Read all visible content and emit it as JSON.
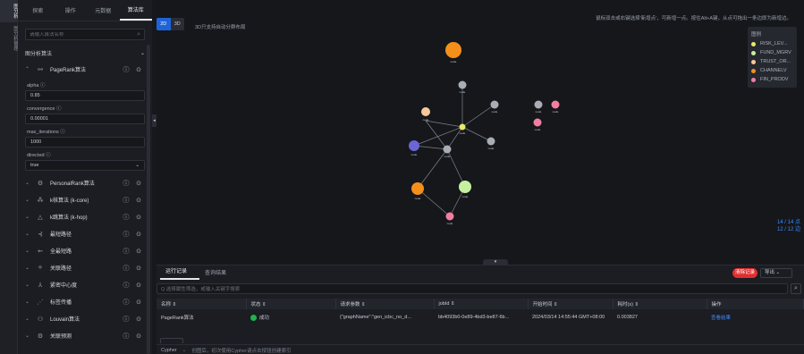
{
  "rail": {
    "items": [
      "图分析",
      "图分析管理"
    ]
  },
  "left": {
    "tabs": [
      "探索",
      "操作",
      "元数据",
      "算法库"
    ],
    "search_placeholder": "请输入算法名称",
    "section_title": "图分析算法",
    "pagerank": {
      "name": "PageRank算法",
      "params": [
        {
          "label": "alpha",
          "value": "0.85"
        },
        {
          "label": "convergence",
          "value": "0.00001"
        },
        {
          "label": "max_iterations",
          "value": "1000"
        },
        {
          "label": "directed",
          "value": "true"
        }
      ]
    },
    "algorithms": [
      "PersonalRank算法",
      "k核算法 (k-core)",
      "k跳算法 (k-hop)",
      "最短路径",
      "全最短路",
      "关联路径",
      "紧密中心度",
      "标签传播",
      "Louvain算法",
      "关联预测"
    ]
  },
  "canvas": {
    "mode_2d": "2D",
    "mode_3d": "3D",
    "hint_3d": "3D只支持自动分群布局",
    "hint_top": "鼠标双击或右键选择'新增点'，可新增一点。按住Alt+A键，从点可拖出一条边即为新增边。",
    "legend_title": "图例",
    "legend": [
      {
        "label": "RISK_LEV...",
        "color": "#e8e86a"
      },
      {
        "label": "FUND_MGRV",
        "color": "#c6f0a0"
      },
      {
        "label": "TRUST_OR...",
        "color": "#f6c89a"
      },
      {
        "label": "CHANNELV",
        "color": "#f4901a"
      },
      {
        "label": "FIN_PRODV",
        "color": "#f37ea1"
      }
    ],
    "stats_nodes": "14 / 14 点",
    "stats_edges": "12 / 12 边",
    "node_label": "node"
  },
  "bottom": {
    "tabs": [
      "运行记录",
      "查询结果"
    ],
    "clear_label": "清除记录",
    "export_label": "导出",
    "search_placeholder": "Q 选择属性筛选，或输入关键字搜索",
    "columns": [
      "名称 ⇕",
      "状态 ⇕",
      "请求参数 ⇕",
      "jobId ⇕",
      "开始时间 ⇕",
      "耗时(s) ⇕",
      "操作"
    ],
    "row": {
      "name": "PageRank算法",
      "status": "成功",
      "params": "{\"graphName\":\"gen_icbc_no_d...",
      "jobid": "bb4093b0-0e89-4bd3-be87-6b...",
      "start": "2024/03/14 14:55:44 GMT+08:00",
      "duration": "0.003827",
      "action": "查看结果"
    },
    "cypher_label": "Cypher",
    "cypher_hint": "创图后，初次使用Cypher请点击按钮创建索引"
  }
}
